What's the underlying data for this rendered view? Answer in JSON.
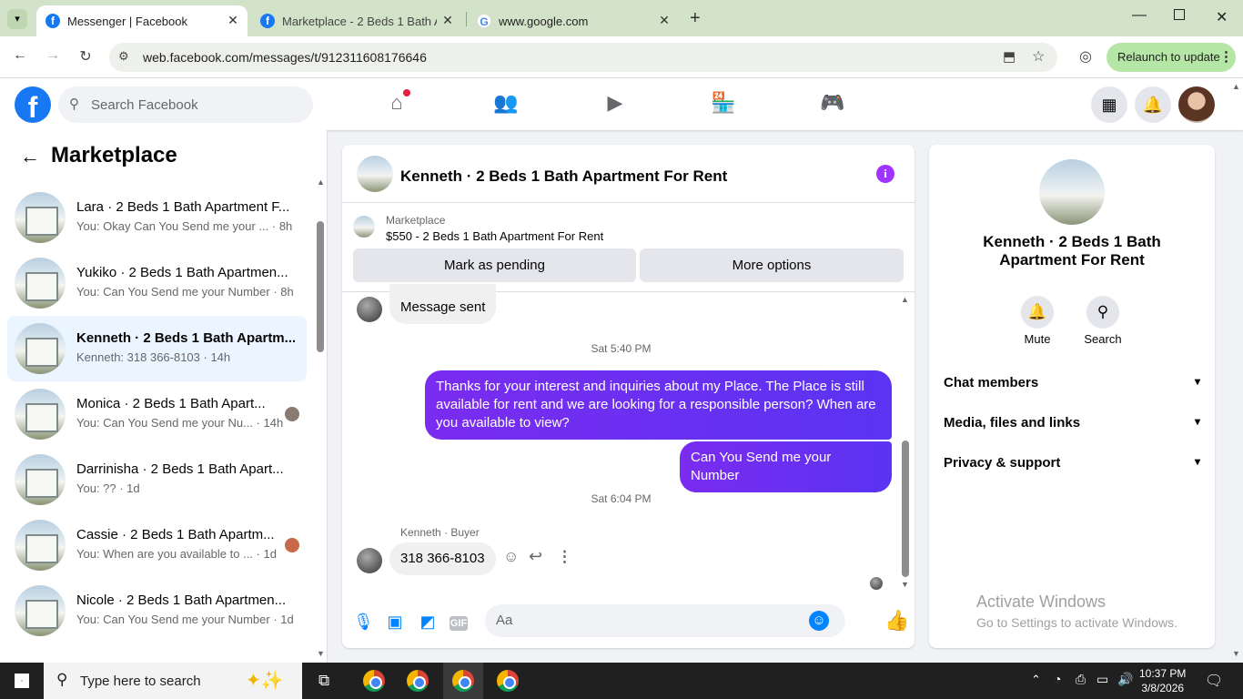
{
  "browser": {
    "tabs": [
      {
        "label": "Messenger | Facebook",
        "active": true
      },
      {
        "label": "Marketplace - 2 Beds 1 Bath Ap",
        "active": false
      },
      {
        "label": "www.google.com",
        "active": false
      }
    ],
    "url": "web.facebook.com/messages/t/912311608176646",
    "relaunch_label": "Relaunch to update"
  },
  "fb_header": {
    "logo": "f",
    "search_placeholder": "Search Facebook",
    "nav_icons": [
      "home-icon",
      "friends-icon",
      "video-icon",
      "marketplace-icon",
      "gaming-icon"
    ],
    "right_icons": [
      "menu-grid-icon",
      "bell-icon",
      "profile-avatar"
    ]
  },
  "left_panel": {
    "title": "Marketplace",
    "conversations": [
      {
        "name": "Lara · 2 Beds 1 Bath Apartment F...",
        "snippet": "You: Okay Can You Send me your ... · 8h",
        "selected": false,
        "seen_avatar": false
      },
      {
        "name": "Yukiko · 2 Beds 1 Bath Apartmen...",
        "snippet": "You: Can You Send me your Number · 8h",
        "selected": false,
        "seen_avatar": false
      },
      {
        "name": "Kenneth · 2 Beds 1 Bath Apartm...",
        "snippet": "Kenneth: 318 366-8103 · 14h",
        "selected": true,
        "seen_avatar": false
      },
      {
        "name": "Monica · 2 Beds 1 Bath Apart...",
        "snippet": "You: Can You Send me your Nu... · 14h",
        "selected": false,
        "seen_avatar": true
      },
      {
        "name": "Darrinisha · 2 Beds 1 Bath Apart...",
        "snippet": "You: ?? · 1d",
        "selected": false,
        "seen_avatar": false
      },
      {
        "name": "Cassie · 2 Beds 1 Bath Apartm...",
        "snippet": "You: When are you available to ... · 1d",
        "selected": false,
        "seen_avatar": true
      },
      {
        "name": "Nicole · 2 Beds 1 Bath Apartmen...",
        "snippet": "You: Can You Send me your Number · 1d",
        "selected": false,
        "seen_avatar": false
      }
    ]
  },
  "chat": {
    "title": "Kenneth · 2 Beds 1 Bath Apartment For Rent",
    "listing_label": "Marketplace",
    "listing_title": "$550 - 2 Beds 1 Bath Apartment For Rent",
    "mark_pending_label": "Mark as pending",
    "more_options_label": "More options",
    "messages": {
      "sent_notice": "Message sent",
      "ts1": "Sat 5:40 PM",
      "out1": "Thanks for your interest and inquiries about my Place. The Place is still available for rent and we are looking for a responsible person? When are you available to view?",
      "out2": "Can You Send me your Number",
      "ts2": "Sat 6:04 PM",
      "sender_label": "Kenneth · Buyer",
      "in1": "318 366-8103"
    },
    "composer_placeholder": "Aa"
  },
  "right_panel": {
    "title": "Kenneth · 2 Beds 1 Bath Apartment For Rent",
    "mute_label": "Mute",
    "search_label": "Search",
    "sections": [
      "Chat members",
      "Media, files and links",
      "Privacy & support"
    ],
    "watermark_title": "Activate Windows",
    "watermark_sub": "Go to Settings to activate Windows."
  },
  "taskbar": {
    "search_placeholder": "Type here to search",
    "time": "10:37 PM",
    "date": "3/8/2026"
  },
  "colors": {
    "fb_blue": "#1877f2",
    "bubble_purple": "#7a2cf0",
    "info_purple": "#a033ff",
    "selected_row": "#ebf5ff"
  }
}
